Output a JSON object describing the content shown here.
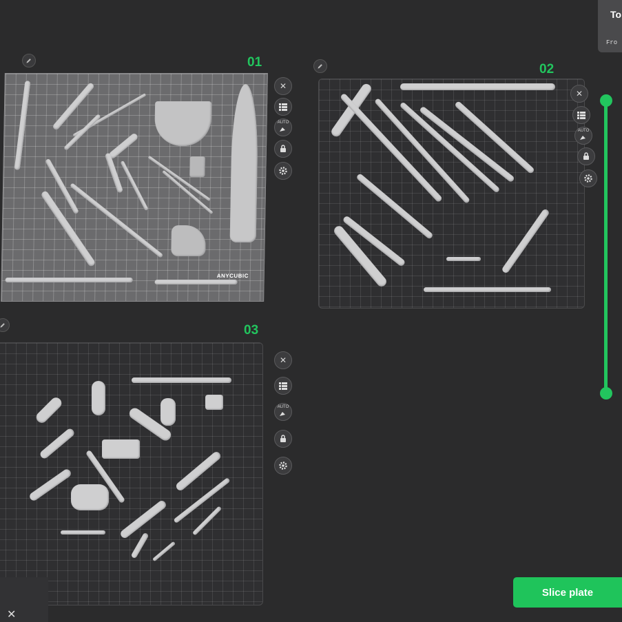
{
  "plates": [
    {
      "number": "01",
      "tools": [
        "close-icon",
        "list-icon",
        "auto-arrange-icon",
        "lock-icon",
        "gear-icon"
      ],
      "brand": "ANYCUBIC"
    },
    {
      "number": "02",
      "tools": [
        "close-icon",
        "list-icon",
        "auto-arrange-icon",
        "lock-icon",
        "gear-icon"
      ]
    },
    {
      "number": "03",
      "tools": [
        "close-icon",
        "list-icon",
        "auto-arrange-icon",
        "lock-icon",
        "gear-icon"
      ]
    }
  ],
  "auto_label": "AUTO",
  "top_panel": {
    "title": "To",
    "sub": "Fro"
  },
  "actions": {
    "slice_plate": "Slice plate"
  },
  "layer_slider": {
    "value": 1.0
  },
  "close_glyph": "✕"
}
